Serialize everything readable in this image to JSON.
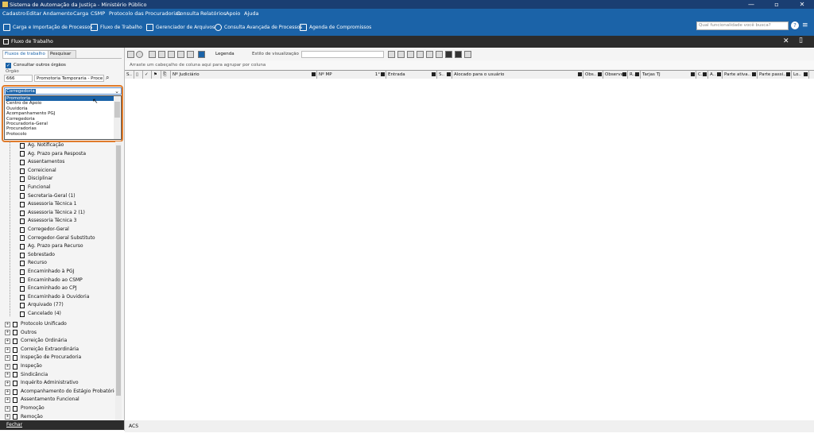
{
  "window": {
    "title": "Sistema de Automação da Justiça - Ministério Público",
    "controls": [
      "—",
      "▫",
      "✕"
    ]
  },
  "menu": [
    "Cadastro",
    "Editar",
    "Andamento",
    "Carga",
    "CSMP",
    "Protocolo das Procuradorias",
    "Consulta",
    "Relatórios",
    "Apoio",
    "Ajuda"
  ],
  "toolbar": {
    "items": [
      "Carga e Importação de Processos",
      "Fluxo de Trabalho",
      "Gerenciador de Arquivos",
      "Consulta Avançada de Processos",
      "Agenda de Compromissos"
    ],
    "search_placeholder": "Qual funcionalidade você busca?",
    "help": "?",
    "menu": "≡"
  },
  "panel": {
    "title": "Fluxo de Trabalho",
    "close": "✕"
  },
  "left": {
    "tabs": [
      "Fluxos de trabalho",
      "Pesquisar"
    ],
    "checkbox_label": "Consultar outros órgãos",
    "orgao_label": "Órgão",
    "orgao_code": "666",
    "orgao_name": "Promotoria Temporaria - Proce",
    "dropdown_value": "Corregedoria",
    "dropdown_options": [
      "Promotoria",
      "Centro de Apoio",
      "Ouvidoria",
      "Acompanhamento PGJ",
      "Corregedoria",
      "Procuradoria-Geral",
      "Procuradorias",
      "Protocolo"
    ],
    "selected_option": "Promotoria",
    "tree_children": [
      "Ag. Notificação",
      "Ag. Prazo para Resposta",
      "Assentamentos",
      "Correicional",
      "Disciplinar",
      "Funcional",
      "Secretaria-Geral (1)",
      "Assessoria Técnica 1",
      "Assessoria Técnica 2 (1)",
      "Assessoria Técnica 3",
      "Corregedor-Geral",
      "Corregedor-Geral Substituto",
      "Ag. Prazo para Recurso",
      "Sobrestado",
      "Recurso",
      "Encaminhado à PGJ",
      "Encaminhado ao CSMP",
      "Encaminhado ao CPJ",
      "Encaminhado à Ouvidoria",
      "Arquivado (77)",
      "Cancelado (4)"
    ],
    "tree_roots": [
      "Protocolo Unificado",
      "Outros",
      "Correição Ordinária",
      "Correição Extraordinária",
      "Inspeção de Procuradoria",
      "Inspeção",
      "Sindicância",
      "Inquérito Administrativo",
      "Acompanhamento do Estágio Probatório",
      "Assentamento Funcional",
      "Promoção",
      "Remoção"
    ],
    "close_label": "Fechar"
  },
  "right": {
    "legend_label": "Legenda",
    "view_style_label": "Estilo de visualização",
    "group_hint": "Arraste um cabeçalho de coluna aqui para agrupar por coluna",
    "columns": [
      "S..",
      "",
      "",
      "",
      "Nº Judiciário",
      "Nº MP",
      "1°",
      "Entrada",
      "S..",
      "Alocado para o usuário",
      "Obs..",
      "Observa..",
      "R..",
      "Tarjas TJ",
      "C..",
      "A..",
      "Parte ativa..",
      "Parte passi..",
      "Lo.."
    ],
    "status": "ACS"
  },
  "colors": {
    "title": "#1a3e72",
    "menu": "#1b63a8",
    "highlight": "#e07b2a",
    "dark": "#2c2c2c"
  }
}
